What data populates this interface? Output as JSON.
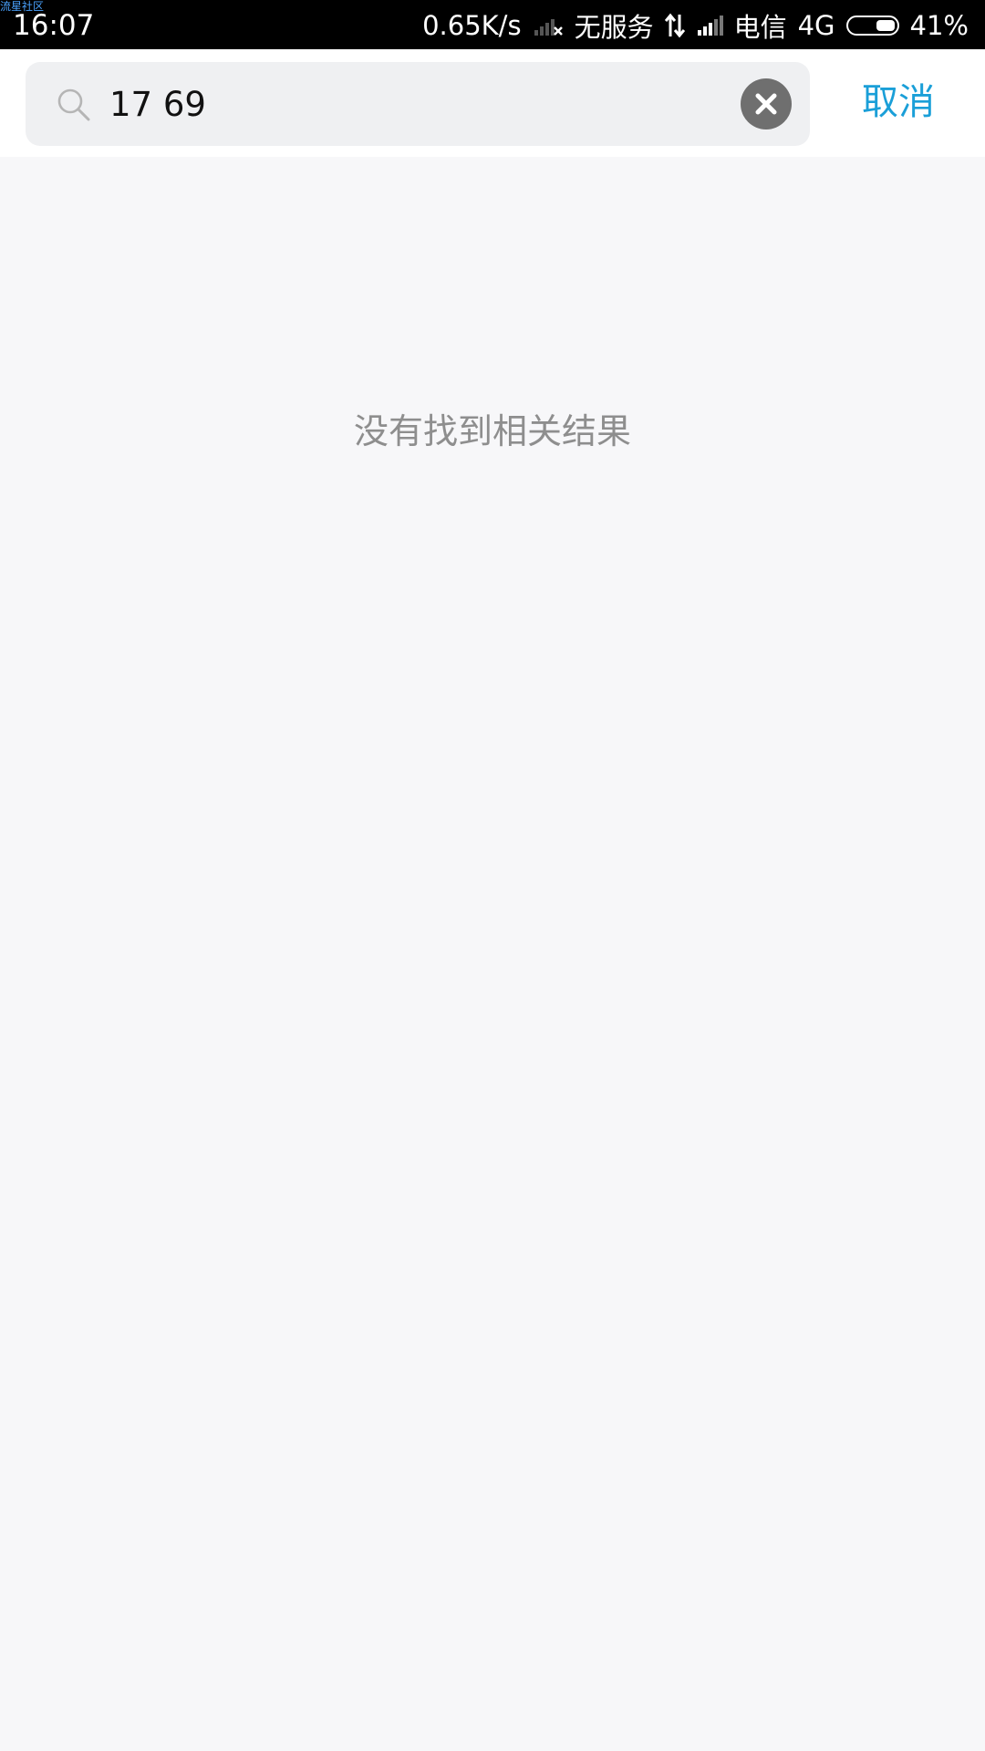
{
  "status_bar": {
    "watermark": "流星社区",
    "time": "16:07",
    "net_speed": "0.65K/s",
    "no_service": "无服务",
    "carrier": "电信",
    "network": "4G",
    "battery": "41%",
    "battery_level": 0.41,
    "icons": [
      "signal-none-icon",
      "data-arrows-icon",
      "signal-icon",
      "battery-icon"
    ]
  },
  "search": {
    "query": "17 69",
    "clear_icon": "close-icon",
    "search_icon": "search-icon",
    "cancel_label": "取消"
  },
  "results": {
    "empty_message": "没有找到相关结果"
  },
  "colors": {
    "accent": "#1a9fd8",
    "page_background": "#f7f7f9",
    "search_box_background": "#eff0f2",
    "status_bar_background": "#000000"
  }
}
